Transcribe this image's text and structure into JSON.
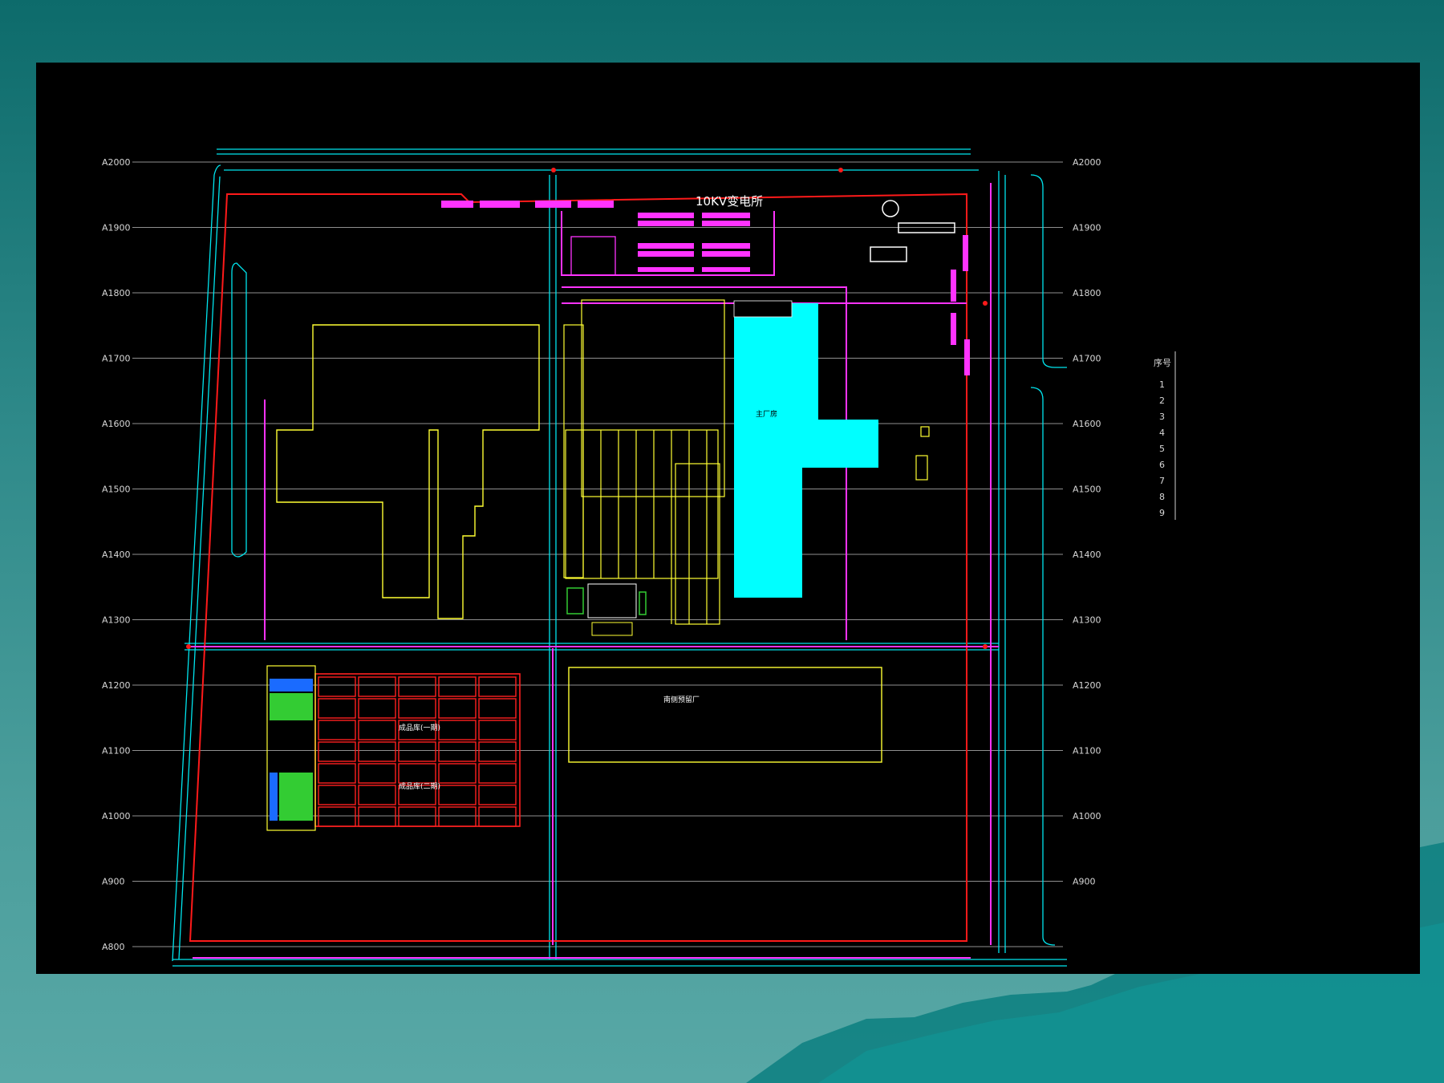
{
  "slide": {
    "background_top": "#0d6b6b",
    "background_bottom": "#58a8a6",
    "panel_color": "#000000"
  },
  "plan": {
    "colors": {
      "grid": "#bfbfbf",
      "road": "#00e5ee",
      "site_boundary": "#ff1a1a",
      "building_outline": "#ffff33",
      "pipe": "#ff33ff",
      "main_building_fill": "#00ffff",
      "storage_red": "#ff2020",
      "green_fill": "#33cc33",
      "blue_fill": "#1a6bff"
    },
    "grid_left": [
      "A2000",
      "A1900",
      "A1800",
      "A1700",
      "A1600",
      "A1500",
      "A1400",
      "A1300",
      "A1200",
      "A1100",
      "A1000",
      "A900",
      "A800"
    ],
    "grid_right": [
      "A2000",
      "A1900",
      "A1800",
      "A1700",
      "A1600",
      "A1500",
      "A1400",
      "A1300",
      "A1200",
      "A1100",
      "A1000",
      "A900"
    ],
    "labels": {
      "substation": "10KV变电所",
      "main_workshop": "主厂房",
      "south_plant": "南侧预留厂",
      "storage_1": "成品库(一期)",
      "storage_2": "成品库(二期)"
    },
    "legend": {
      "header": "序号",
      "rows": [
        "1",
        "2",
        "3",
        "4",
        "5",
        "6",
        "7",
        "8",
        "9"
      ]
    }
  }
}
